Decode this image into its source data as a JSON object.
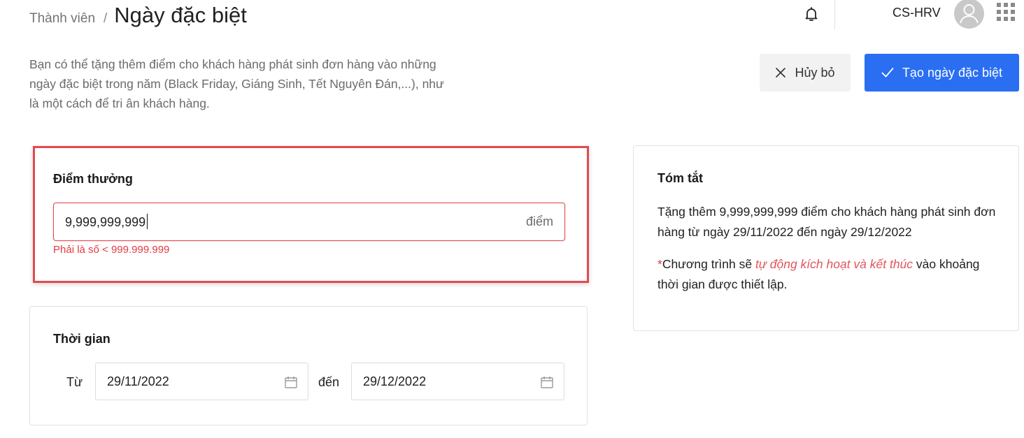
{
  "breadcrumb": {
    "parent": "Thành viên",
    "separator": "/",
    "title": "Ngày đặc biệt"
  },
  "header": {
    "user_name": "CS-HRV"
  },
  "description": "Bạn có thể tặng thêm điểm cho khách hàng phát sinh đơn hàng vào những ngày đặc biệt trong năm (Black Friday, Giáng Sinh, Tết Nguyên Đán,...), như là một cách để tri ân khách hàng.",
  "actions": {
    "cancel_label": "Hủy bỏ",
    "create_label": "Tạo ngày đặc biệt"
  },
  "points": {
    "title": "Điểm thưởng",
    "value": "9,999,999,999",
    "unit": "điểm",
    "error": "Phải là số < 999.999.999"
  },
  "time": {
    "title": "Thời gian",
    "from_label": "Từ",
    "from_value": "29/11/2022",
    "to_label": "đến",
    "to_value": "29/12/2022"
  },
  "summary": {
    "title": "Tóm tắt",
    "text": "Tặng thêm 9,999,999,999 điểm cho khách hàng phát sinh đơn hàng từ ngày 29/11/2022 đến ngày 29/12/2022",
    "note_asterisk": "*",
    "note_prefix": "Chương trình sẽ ",
    "note_highlight": "tự động kích hoạt và kết thúc",
    "note_suffix": " vào khoảng thời gian được thiết lập."
  },
  "colors": {
    "primary": "#2a6ff2",
    "error": "#e23a44",
    "highlight_border": "#e24a4f"
  },
  "icons": {
    "bell": "bell-icon",
    "avatar": "user-avatar-icon",
    "apps": "apps-grid-icon",
    "cancel": "close-icon",
    "create": "check-icon",
    "calendar": "calendar-icon"
  }
}
